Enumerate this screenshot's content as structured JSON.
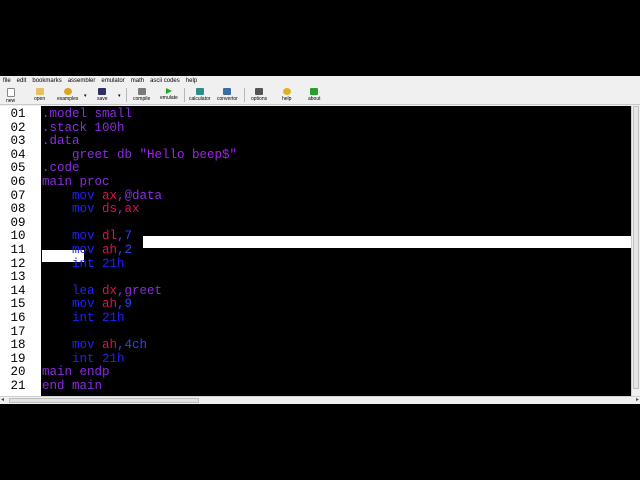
{
  "menu": [
    "file",
    "edit",
    "bookmarks",
    "assembler",
    "emulator",
    "math",
    "ascii codes",
    "help"
  ],
  "toolbar": {
    "new": "new",
    "open": "open",
    "examples": "examples",
    "save": "save",
    "compile": "compile",
    "emulate": "emulate",
    "calculator": "calculator",
    "convertor": "convertor",
    "options": "options",
    "help": "help",
    "about": "about"
  },
  "lines": [
    {
      "num": "01",
      "tokens": [
        {
          "t": ".model small",
          "c": "dir"
        }
      ]
    },
    {
      "num": "02",
      "tokens": [
        {
          "t": ".stack 100h",
          "c": "dir"
        }
      ]
    },
    {
      "num": "03",
      "tokens": [
        {
          "t": ".data",
          "c": "dir"
        }
      ]
    },
    {
      "num": "04",
      "tokens": [
        {
          "t": "    greet db ",
          "c": "var"
        },
        {
          "t": "\"Hello beep$\"",
          "c": "str"
        }
      ]
    },
    {
      "num": "05",
      "tokens": [
        {
          "t": ".code",
          "c": "dir"
        }
      ]
    },
    {
      "num": "06",
      "tokens": [
        {
          "t": "main proc",
          "c": "dir"
        }
      ]
    },
    {
      "num": "07",
      "tokens": [
        {
          "t": "    mov ",
          "c": "ins"
        },
        {
          "t": "ax",
          "c": "reg"
        },
        {
          "t": ",@data",
          "c": "var"
        }
      ]
    },
    {
      "num": "08",
      "tokens": [
        {
          "t": "    mov ",
          "c": "ins"
        },
        {
          "t": "ds",
          "c": "reg"
        },
        {
          "t": ",",
          "c": "var"
        },
        {
          "t": "ax",
          "c": "reg"
        }
      ]
    },
    {
      "num": "09",
      "tokens": []
    },
    {
      "num": "10",
      "tokens": [
        {
          "t": "    mov ",
          "c": "ins"
        },
        {
          "t": "dl",
          "c": "reg"
        },
        {
          "t": ",7",
          "c": "num"
        }
      ]
    },
    {
      "num": "11",
      "tokens": [
        {
          "t": "    mov ",
          "c": "ins"
        },
        {
          "t": "ah",
          "c": "reg"
        },
        {
          "t": ",2",
          "c": "num"
        }
      ]
    },
    {
      "num": "12",
      "tokens": [
        {
          "t": "    int 21h",
          "c": "ins"
        }
      ]
    },
    {
      "num": "13",
      "tokens": []
    },
    {
      "num": "14",
      "tokens": [
        {
          "t": "    lea ",
          "c": "ins"
        },
        {
          "t": "dx",
          "c": "reg"
        },
        {
          "t": ",greet",
          "c": "var"
        }
      ]
    },
    {
      "num": "15",
      "tokens": [
        {
          "t": "    mov ",
          "c": "ins"
        },
        {
          "t": "ah",
          "c": "reg"
        },
        {
          "t": ",9",
          "c": "num"
        }
      ]
    },
    {
      "num": "16",
      "tokens": [
        {
          "t": "    int 21h",
          "c": "ins"
        }
      ]
    },
    {
      "num": "17",
      "tokens": []
    },
    {
      "num": "18",
      "tokens": [
        {
          "t": "    mov ",
          "c": "ins"
        },
        {
          "t": "ah",
          "c": "reg"
        },
        {
          "t": ",4ch",
          "c": "num"
        }
      ]
    },
    {
      "num": "19",
      "tokens": [
        {
          "t": "    int 21h",
          "c": "ins"
        }
      ]
    },
    {
      "num": "20",
      "tokens": [
        {
          "t": "main endp",
          "c": "dir"
        }
      ]
    },
    {
      "num": "21",
      "tokens": [
        {
          "t": "end main",
          "c": "dir"
        }
      ]
    }
  ],
  "colors": {
    "directive": "#8a2be2",
    "instruction": "#2020ff",
    "register": "#e01050",
    "number": "#3040ff",
    "string": "#a020f0"
  }
}
